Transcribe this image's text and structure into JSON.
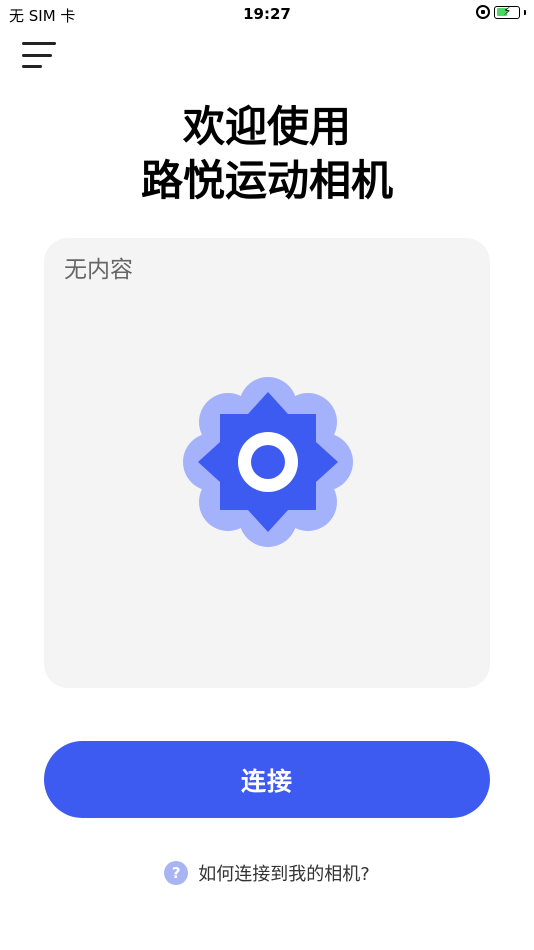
{
  "status_bar": {
    "carrier": "无 SIM 卡",
    "time": "19:27"
  },
  "title": {
    "line1": "欢迎使用",
    "line2": "路悦运动相机"
  },
  "card": {
    "empty_text": "无内容"
  },
  "connect_button": {
    "label": "连接"
  },
  "help": {
    "icon_char": "?",
    "text": "如何连接到我的相机?"
  },
  "colors": {
    "primary": "#3d5af1",
    "petal_light": "#a4b2fb",
    "petal_dark": "#3d5af1"
  }
}
